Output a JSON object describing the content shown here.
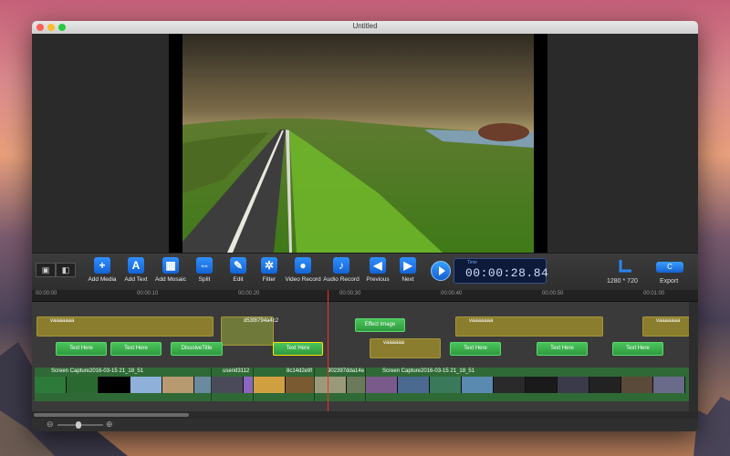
{
  "window": {
    "title": "Untitled"
  },
  "toolbar": {
    "buttons": [
      {
        "label": "Add Media",
        "glyph": "+"
      },
      {
        "label": "Add Text",
        "glyph": "A"
      },
      {
        "label": "Add Mosaic",
        "glyph": "▦"
      },
      {
        "label": "Split",
        "glyph": "⇔"
      },
      {
        "label": "Edit",
        "glyph": "✎"
      },
      {
        "label": "Filter",
        "glyph": "✲"
      },
      {
        "label": "Video Record",
        "glyph": "●"
      },
      {
        "label": "Audio Record",
        "glyph": "♪"
      },
      {
        "label": "Previous",
        "glyph": "◀"
      },
      {
        "label": "Next",
        "glyph": "▶"
      }
    ],
    "timecode_label": "Time",
    "timecode": "00:00:28.84",
    "resolution": "1280 * 720",
    "export_label": "Export",
    "export_icon": "C"
  },
  "ruler": {
    "labels": [
      "00:00:00",
      "00:00:10",
      "00:00:20",
      "00:00:30",
      "00:00:40",
      "00:00:50",
      "00:01:00"
    ]
  },
  "tracks": {
    "effects": [
      {
        "label": "vaaaaaaa"
      },
      {
        "label": "d53f8794a4c2"
      },
      {
        "label": "vaaaaaaa"
      },
      {
        "label": "vaaaaaaa"
      },
      {
        "label": "vaaaaaa"
      },
      {
        "label": "Effect Image"
      }
    ],
    "texts": [
      {
        "label": "Text Here"
      },
      {
        "label": "Text Here"
      },
      {
        "label": "DissolveTitle"
      },
      {
        "label": "Text Here"
      },
      {
        "label": "Text Here"
      },
      {
        "label": "Text Here"
      },
      {
        "label": "Text Here"
      }
    ],
    "video": [
      {
        "label": "Screen Capture2016-03-15 21_18_51"
      },
      {
        "label": "userid3112"
      },
      {
        "label": "8c14d2e9f"
      },
      {
        "label": "902397dda14e"
      },
      {
        "label": "Screen Capture2016-03-15 21_18_51"
      }
    ]
  },
  "icons": [
    "landscape-icon",
    "split-view-icon",
    "play-icon",
    "zoom-out-icon",
    "zoom-in-icon",
    "resolution-icon"
  ],
  "colors": {
    "accent": "#2a86f0",
    "playhead": "#ff2a2a",
    "text_clip": "#3fb34f",
    "effect_clip": "#8b7d2e",
    "video_track": "#2f6a36"
  }
}
